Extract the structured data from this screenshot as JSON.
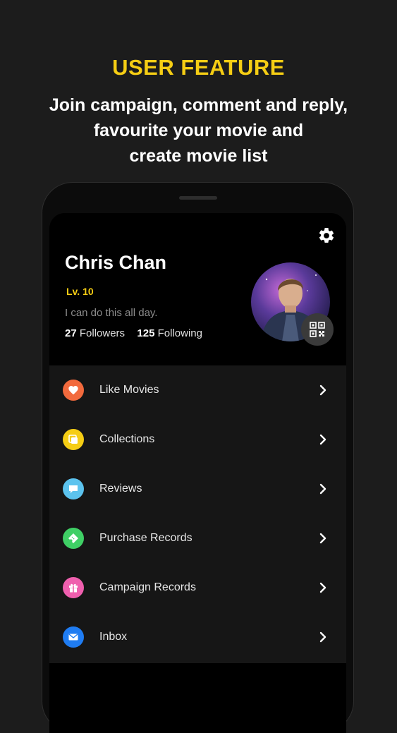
{
  "promo": {
    "headline": "USER FEATURE",
    "lines": [
      "Join campaign, comment and reply,",
      "favourite your movie and",
      "create movie list"
    ]
  },
  "profile": {
    "name": "Chris Chan",
    "level": "Lv. 10",
    "bio": "I can do this all day.",
    "followers_count": "27",
    "followers_label": "Followers",
    "following_count": "125",
    "following_label": "Following",
    "settings_icon": "gear-icon",
    "qr_icon": "qr-code-icon"
  },
  "menu": {
    "items": [
      {
        "label": "Like Movies",
        "icon": "heart-icon",
        "color": "#f26a3d"
      },
      {
        "label": "Collections",
        "icon": "collections-icon",
        "color": "#f5cd14"
      },
      {
        "label": "Reviews",
        "icon": "comment-icon",
        "color": "#5cc3ee"
      },
      {
        "label": "Purchase Records",
        "icon": "ticket-icon",
        "color": "#3fcf65"
      },
      {
        "label": "Campaign Records",
        "icon": "gift-icon",
        "color": "#ef5fae"
      },
      {
        "label": "Inbox",
        "icon": "mail-icon",
        "color": "#1f7cf2"
      }
    ]
  },
  "colors": {
    "accent": "#f5cd14",
    "background": "#1c1c1c",
    "screen": "#000000",
    "menu_background": "#161616"
  }
}
